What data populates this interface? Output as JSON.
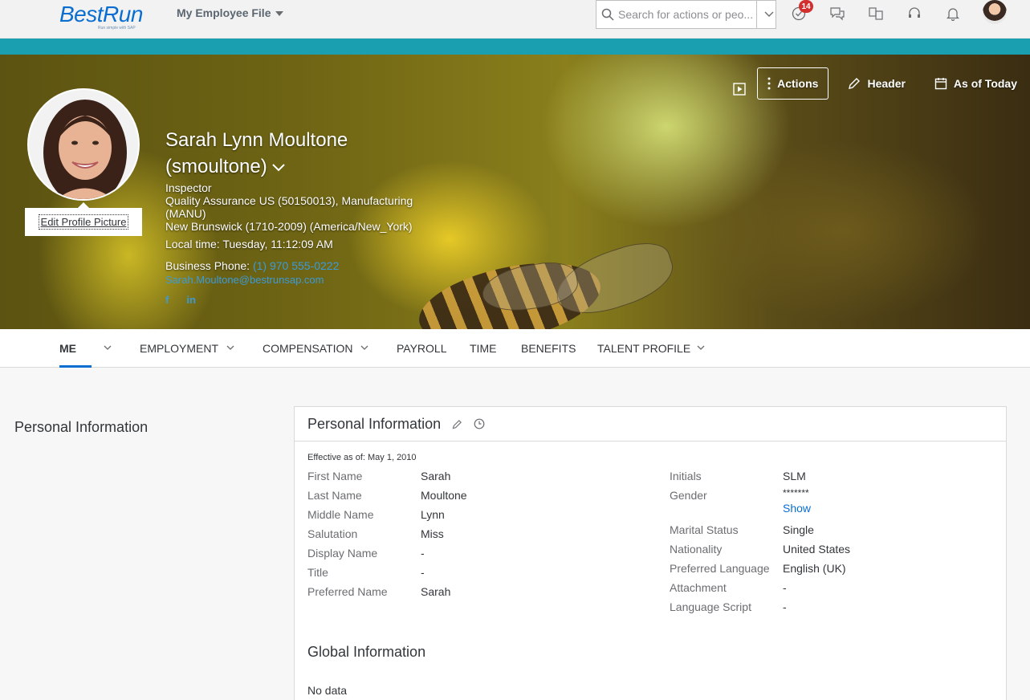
{
  "shell": {
    "logo_text": "BestRun",
    "logo_tagline": "Run simple with SAP",
    "module_title": "My Employee File",
    "search_placeholder": "Search for actions or peo...",
    "todo_badge": "14"
  },
  "profile": {
    "name_line1": "Sarah Lynn Moultone",
    "name_line2": "(smoultone)",
    "edit_picture": "Edit Profile Picture",
    "title": "Inspector",
    "department": "Quality Assurance US (50150013), Manufacturing (MANU)",
    "location": "New Brunswick (1710-2009) (America/New_York)",
    "local_time": "Local time: Tuesday, 11:12:09 AM",
    "phone_label": "Business Phone:",
    "phone": "(1) 970 555-0222",
    "email": "Sarah.Moultone@bestrunsap.com",
    "facebook": "f",
    "linkedin": "in"
  },
  "hero_actions": {
    "actions": "Actions",
    "header": "Header",
    "as_of_today": "As of Today"
  },
  "tabs": [
    "ME",
    "EMPLOYMENT",
    "COMPENSATION",
    "PAYROLL",
    "TIME",
    "BENEFITS",
    "TALENT PROFILE"
  ],
  "content": {
    "side_title": "Personal Information",
    "card_title": "Personal Information",
    "effective": "Effective as of: May 1, 2010",
    "left_fields": [
      {
        "label": "First Name",
        "value": "Sarah"
      },
      {
        "label": "Last Name",
        "value": "Moultone"
      },
      {
        "label": "Middle Name",
        "value": "Lynn"
      },
      {
        "label": "Salutation",
        "value": "Miss"
      },
      {
        "label": "Display Name",
        "value": "-"
      },
      {
        "label": "Title",
        "value": "-"
      },
      {
        "label": "Preferred Name",
        "value": "Sarah"
      }
    ],
    "right_fields": {
      "initials_label": "Initials",
      "initials": "SLM",
      "gender_label": "Gender",
      "gender": "*******",
      "gender_show": "Show",
      "marital_label": "Marital Status",
      "marital": "Single",
      "nationality_label": "Nationality",
      "nationality": "United States",
      "language_label": "Preferred Language",
      "language": "English (UK)",
      "attachment_label": "Attachment",
      "attachment": "-",
      "script_label": "Language Script",
      "script": "-"
    },
    "global_title": "Global Information",
    "global_nodata": "No data"
  }
}
